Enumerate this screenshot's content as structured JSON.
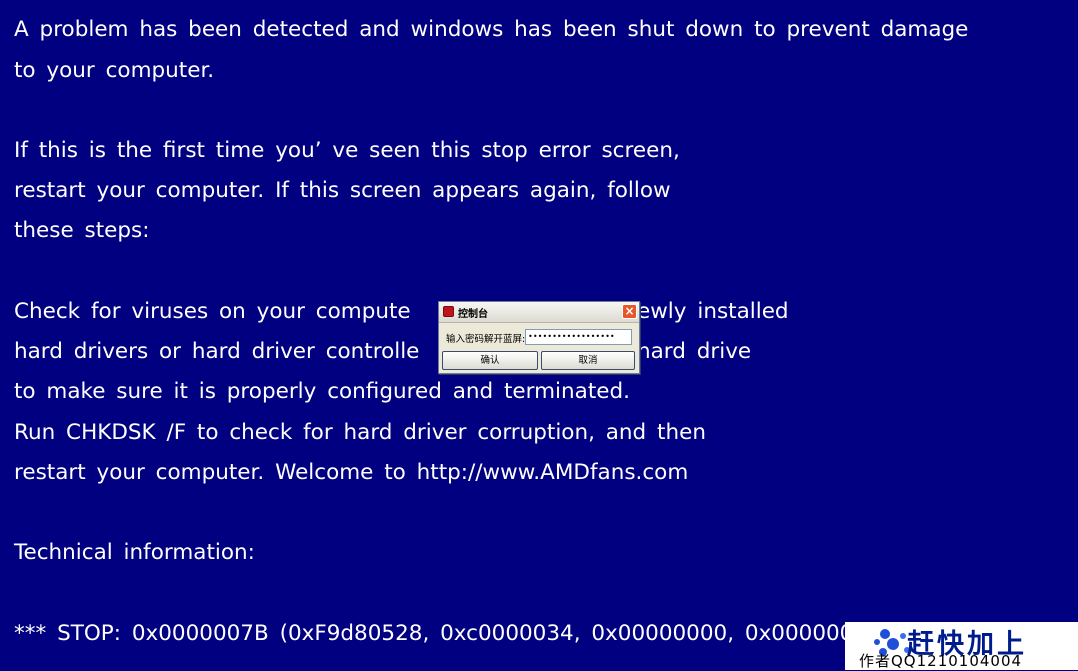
{
  "bsod": {
    "lines": [
      "A problem has been detected and windows has been shut down to prevent damage",
      "to your computer.",
      "If this is the first time you’ ve seen this stop error screen,",
      "restart your computer. If this screen appears again, follow",
      "these steps:",
      "Check for viruses on your compute",
      "ewly installed",
      "hard drivers or hard driver controlle",
      "hard drive",
      "to make sure it is properly configured and terminated.",
      "Run CHKDSK /F to check for hard driver corruption, and then",
      "restart your computer. Welcome to http://www.AMDfans.com",
      "Technical information:",
      "*** STOP: 0x0000007B (0xF9d80528, 0xc0000034, 0x00000000, 0x0000000"
    ]
  },
  "dialog": {
    "title": "控制台",
    "close_label": "×",
    "prompt_label": "输入密码解开蓝屏:",
    "password_value": "••••••••••••••••••",
    "ok_label": "确认",
    "cancel_label": "取消"
  },
  "watermark": {
    "title": "赶快加上",
    "subtitle": "作者QQ1210104004"
  },
  "colors": {
    "background": "#000080",
    "text": "#ffffff"
  }
}
